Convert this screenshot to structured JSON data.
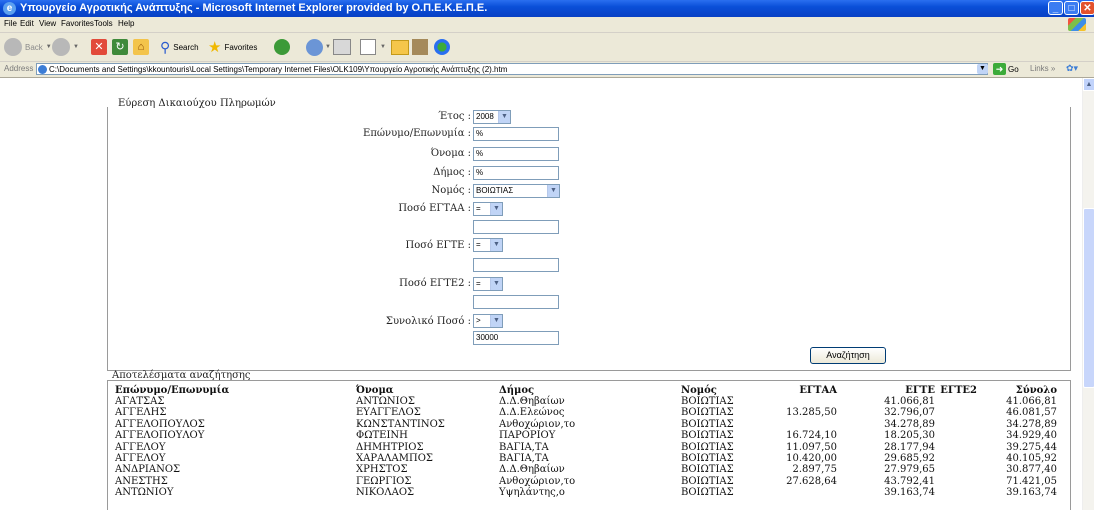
{
  "window": {
    "title": "Υπουργείο Αγροτικής Ανάπτυξης - Microsoft Internet Explorer provided by Ο.Π.Ε.Κ.Ε.Π.Ε."
  },
  "menu": {
    "items": [
      "File",
      "Edit",
      "View",
      "Favorites",
      "Tools",
      "Help"
    ]
  },
  "toolbar": {
    "back": "Back",
    "search": "Search",
    "favorites": "Favorites"
  },
  "address": {
    "label": "Address",
    "value": "C:\\Documents and Settings\\kkountouris\\Local Settings\\Temporary Internet Files\\OLK109\\Υπουργείο Αγροτικής Ανάπτυξης (2).htm",
    "go": "Go",
    "links": "Links"
  },
  "search_form": {
    "title": "Εύρεση Δικαιούχου Πληρωμών",
    "year_label": "Έτος :",
    "year_value": "2008",
    "surname_label": "Επώνυμο/Επωνυμία :",
    "surname_value": "%",
    "name_label": "Όνομα :",
    "name_value": "%",
    "municipality_label": "Δήμος :",
    "municipality_value": "%",
    "prefecture_label": "Νομός :",
    "prefecture_value": "ΒΟΙΩΤΙΑΣ",
    "eggaa_label": "Ποσό ΕΓΤΑΑ :",
    "eggaa_op": "=",
    "eggaa_value": "",
    "egte_label": "Ποσό ΕΓΤΕ :",
    "egte_op": "=",
    "egte_value": "",
    "egte2_label": "Ποσό ΕΓΤΕ2 :",
    "egte2_op": "=",
    "egte2_value": "",
    "total_label": "Συνολικό Ποσό :",
    "total_op": ">",
    "total_value": "30000",
    "search_button": "Αναζήτηση"
  },
  "results": {
    "title": "Αποτελέσματα αναζήτησης",
    "columns": [
      "Επώνυμο/Επωνυμία",
      "Όνομα",
      "Δήμος",
      "Νομός",
      "ΕΓΤΑΑ",
      "ΕΓΤΕ",
      "ΕΓΤΕ2",
      "Σύνολο"
    ],
    "rows": [
      [
        "ΑΓΑΤΣΑΣ",
        "ΑΝΤΩΝΙΟΣ",
        "Δ.Δ.Θηβαίων",
        "ΒΟΙΩΤΙΑΣ",
        "",
        "41.066,81",
        "",
        "41.066,81"
      ],
      [
        "ΑΓΓΕΛΗΣ",
        "ΕΥΑΓΓΕΛΟΣ",
        "Δ.Δ.Ελεώνος",
        "ΒΟΙΩΤΙΑΣ",
        "13.285,50",
        "32.796,07",
        "",
        "46.081,57"
      ],
      [
        "ΑΓΓΕΛΟΠΟΥΛΟΣ",
        "ΚΩΝΣΤΑΝΤΙΝΟΣ",
        "Ανθοχώριον,το",
        "ΒΟΙΩΤΙΑΣ",
        "",
        "34.278,89",
        "",
        "34.278,89"
      ],
      [
        "ΑΓΓΕΛΟΠΟΥΛΟΥ",
        "ΦΩΤΕΙΝΗ",
        "ΠΑΡΟΡΙΟΥ",
        "ΒΟΙΩΤΙΑΣ",
        "16.724,10",
        "18.205,30",
        "",
        "34.929,40"
      ],
      [
        "ΑΓΓΕΛΟΥ",
        "ΔΗΜΗΤΡΙΟΣ",
        "ΒΑΓΙΑ,ΤΑ",
        "ΒΟΙΩΤΙΑΣ",
        "11.097,50",
        "28.177,94",
        "",
        "39.275,44"
      ],
      [
        "ΑΓΓΕΛΟΥ",
        "ΧΑΡΑΛΑΜΠΟΣ",
        "ΒΑΓΙΑ,ΤΑ",
        "ΒΟΙΩΤΙΑΣ",
        "10.420,00",
        "29.685,92",
        "",
        "40.105,92"
      ],
      [
        "ΑΝΔΡΙΑΝΟΣ",
        "ΧΡΗΣΤΟΣ",
        "Δ.Δ.Θηβαίων",
        "ΒΟΙΩΤΙΑΣ",
        "2.897,75",
        "27.979,65",
        "",
        "30.877,40"
      ],
      [
        "ΑΝΕΣΤΗΣ",
        "ΓΕΩΡΓΙΟΣ",
        "Ανθοχώριον,το",
        "ΒΟΙΩΤΙΑΣ",
        "27.628,64",
        "43.792,41",
        "",
        "71.421,05"
      ],
      [
        "ΑΝΤΩΝΙΟΥ",
        "ΝΙΚΟΛΑΟΣ",
        "Υψηλάντης,ο",
        "ΒΟΙΩΤΙΑΣ",
        "",
        "39.163,74",
        "",
        "39.163,74"
      ]
    ]
  }
}
